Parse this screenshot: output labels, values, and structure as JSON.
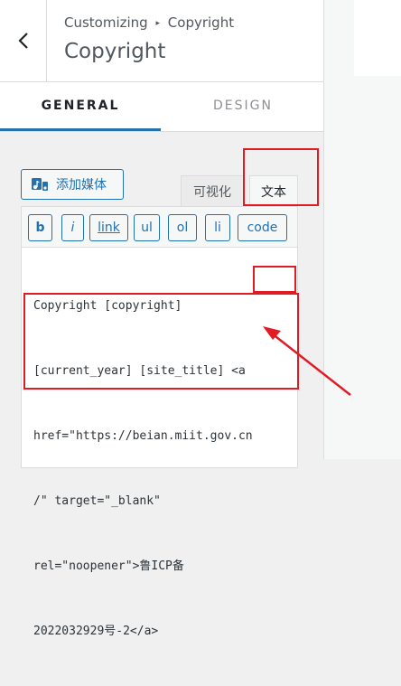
{
  "header": {
    "breadcrumb_parent": "Customizing",
    "breadcrumb_current": "Copyright",
    "breadcrumb_separator": "▸",
    "title": "Copyright"
  },
  "tabs": [
    {
      "label": "GENERAL",
      "active": true
    },
    {
      "label": "DESIGN",
      "active": false
    }
  ],
  "editor": {
    "add_media_label": "添加媒体",
    "mode_tabs": {
      "visual": "可视化",
      "text": "文本",
      "active": "文本"
    },
    "quicktags": [
      "b",
      "i",
      "link",
      "ul",
      "ol",
      "li",
      "code"
    ],
    "content_lines": [
      "Copyright [copyright]",
      "[current_year] [site_title] <a",
      "href=\"https://beian.miit.gov.cn",
      "/\" target=\"_blank\"",
      "rel=\"noopener\">鲁ICP备",
      "2022032929号-2</a>"
    ]
  },
  "colors": {
    "accent": "#2271b1",
    "annotation": "#e01b24"
  }
}
